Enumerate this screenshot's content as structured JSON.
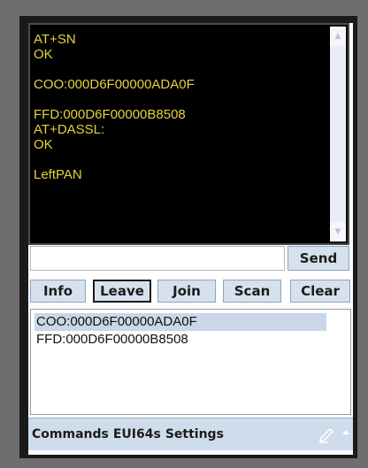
{
  "console": {
    "text": "AT+SN\nOK\n\nCOO:000D6F00000ADA0F\n\nFFD:000D6F00000B8508\nAT+DASSL:\nOK\n\nLeftPAN",
    "text_color": "#e6d23a",
    "background_color": "#000000"
  },
  "command_input": {
    "value": "",
    "placeholder": ""
  },
  "send_button": {
    "label": "Send"
  },
  "buttons": [
    {
      "label": "Info"
    },
    {
      "label": "Leave",
      "focused": true
    },
    {
      "label": "Join"
    },
    {
      "label": "Scan"
    },
    {
      "label": "Clear"
    }
  ],
  "device_list": {
    "items": [
      {
        "label": "COO:000D6F00000ADA0F",
        "selected": true
      },
      {
        "label": "FFD:000D6F00000B8508",
        "selected": false
      }
    ]
  },
  "menubar": {
    "items": [
      {
        "label": "Commands"
      },
      {
        "label": "EUI64s"
      },
      {
        "label": "Settings"
      }
    ],
    "sip_icon": "pen-icon"
  },
  "colors": {
    "button_bg": "#d6e1ee",
    "menubar_bg": "#cfdcec",
    "selection": "#c9d7e8"
  }
}
